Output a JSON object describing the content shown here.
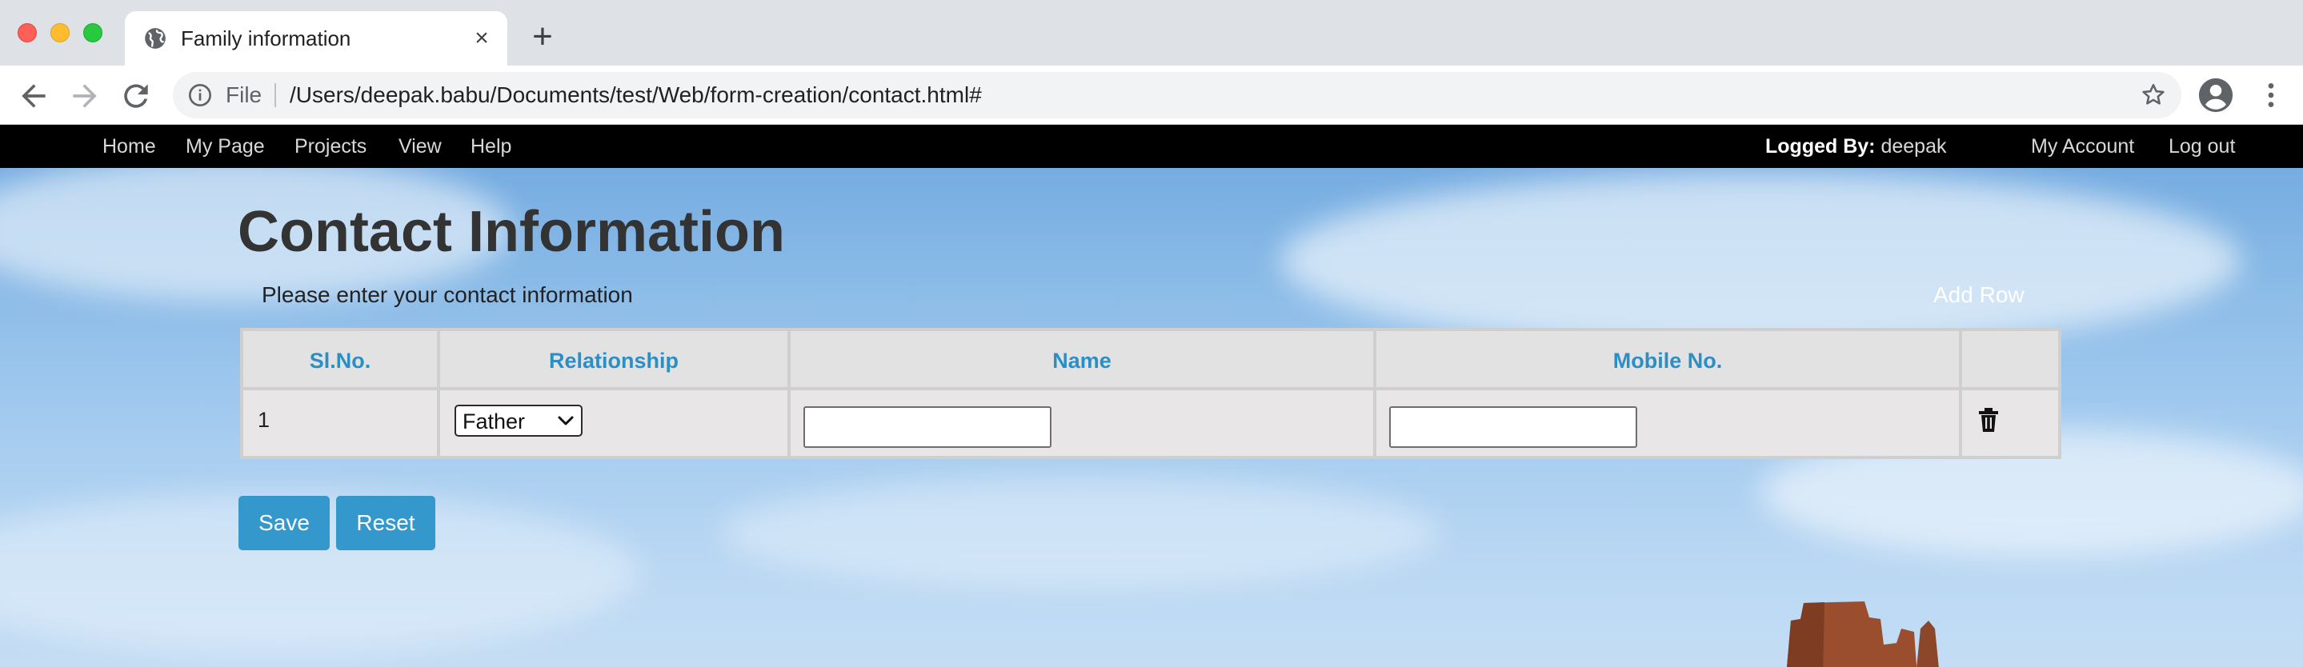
{
  "browser": {
    "tab_title": "Family information",
    "tab_close": "×",
    "new_tab": "+",
    "scheme_label": "File",
    "url": "/Users/deepak.babu/Documents/test/Web/form-creation/contact.html#"
  },
  "navbar": {
    "items": [
      "Home",
      "My Page",
      "Projects",
      "View",
      "Help"
    ],
    "logged_label": "Logged By:",
    "logged_user": "deepak",
    "my_account": "My Account",
    "log_out": "Log out"
  },
  "page": {
    "title": "Contact Information",
    "subtitle": "Please enter your contact information",
    "add_row": "Add Row"
  },
  "table": {
    "headers": [
      "Sl.No.",
      "Relationship",
      "Name",
      "Mobile No.",
      ""
    ],
    "rows": [
      {
        "sno": "1",
        "relationship": "Father",
        "name": "",
        "mobile": ""
      }
    ]
  },
  "buttons": {
    "save": "Save",
    "reset": "Reset"
  },
  "colors": {
    "accent": "#3498cd",
    "header_text": "#2b8fc7",
    "navbar": "#000000"
  },
  "icons": {
    "favicon": "globe-icon",
    "info": "info-icon",
    "bookmark": "star-icon",
    "profile": "account-circle-icon",
    "menu": "more-vertical-icon",
    "delete": "trash-icon"
  }
}
